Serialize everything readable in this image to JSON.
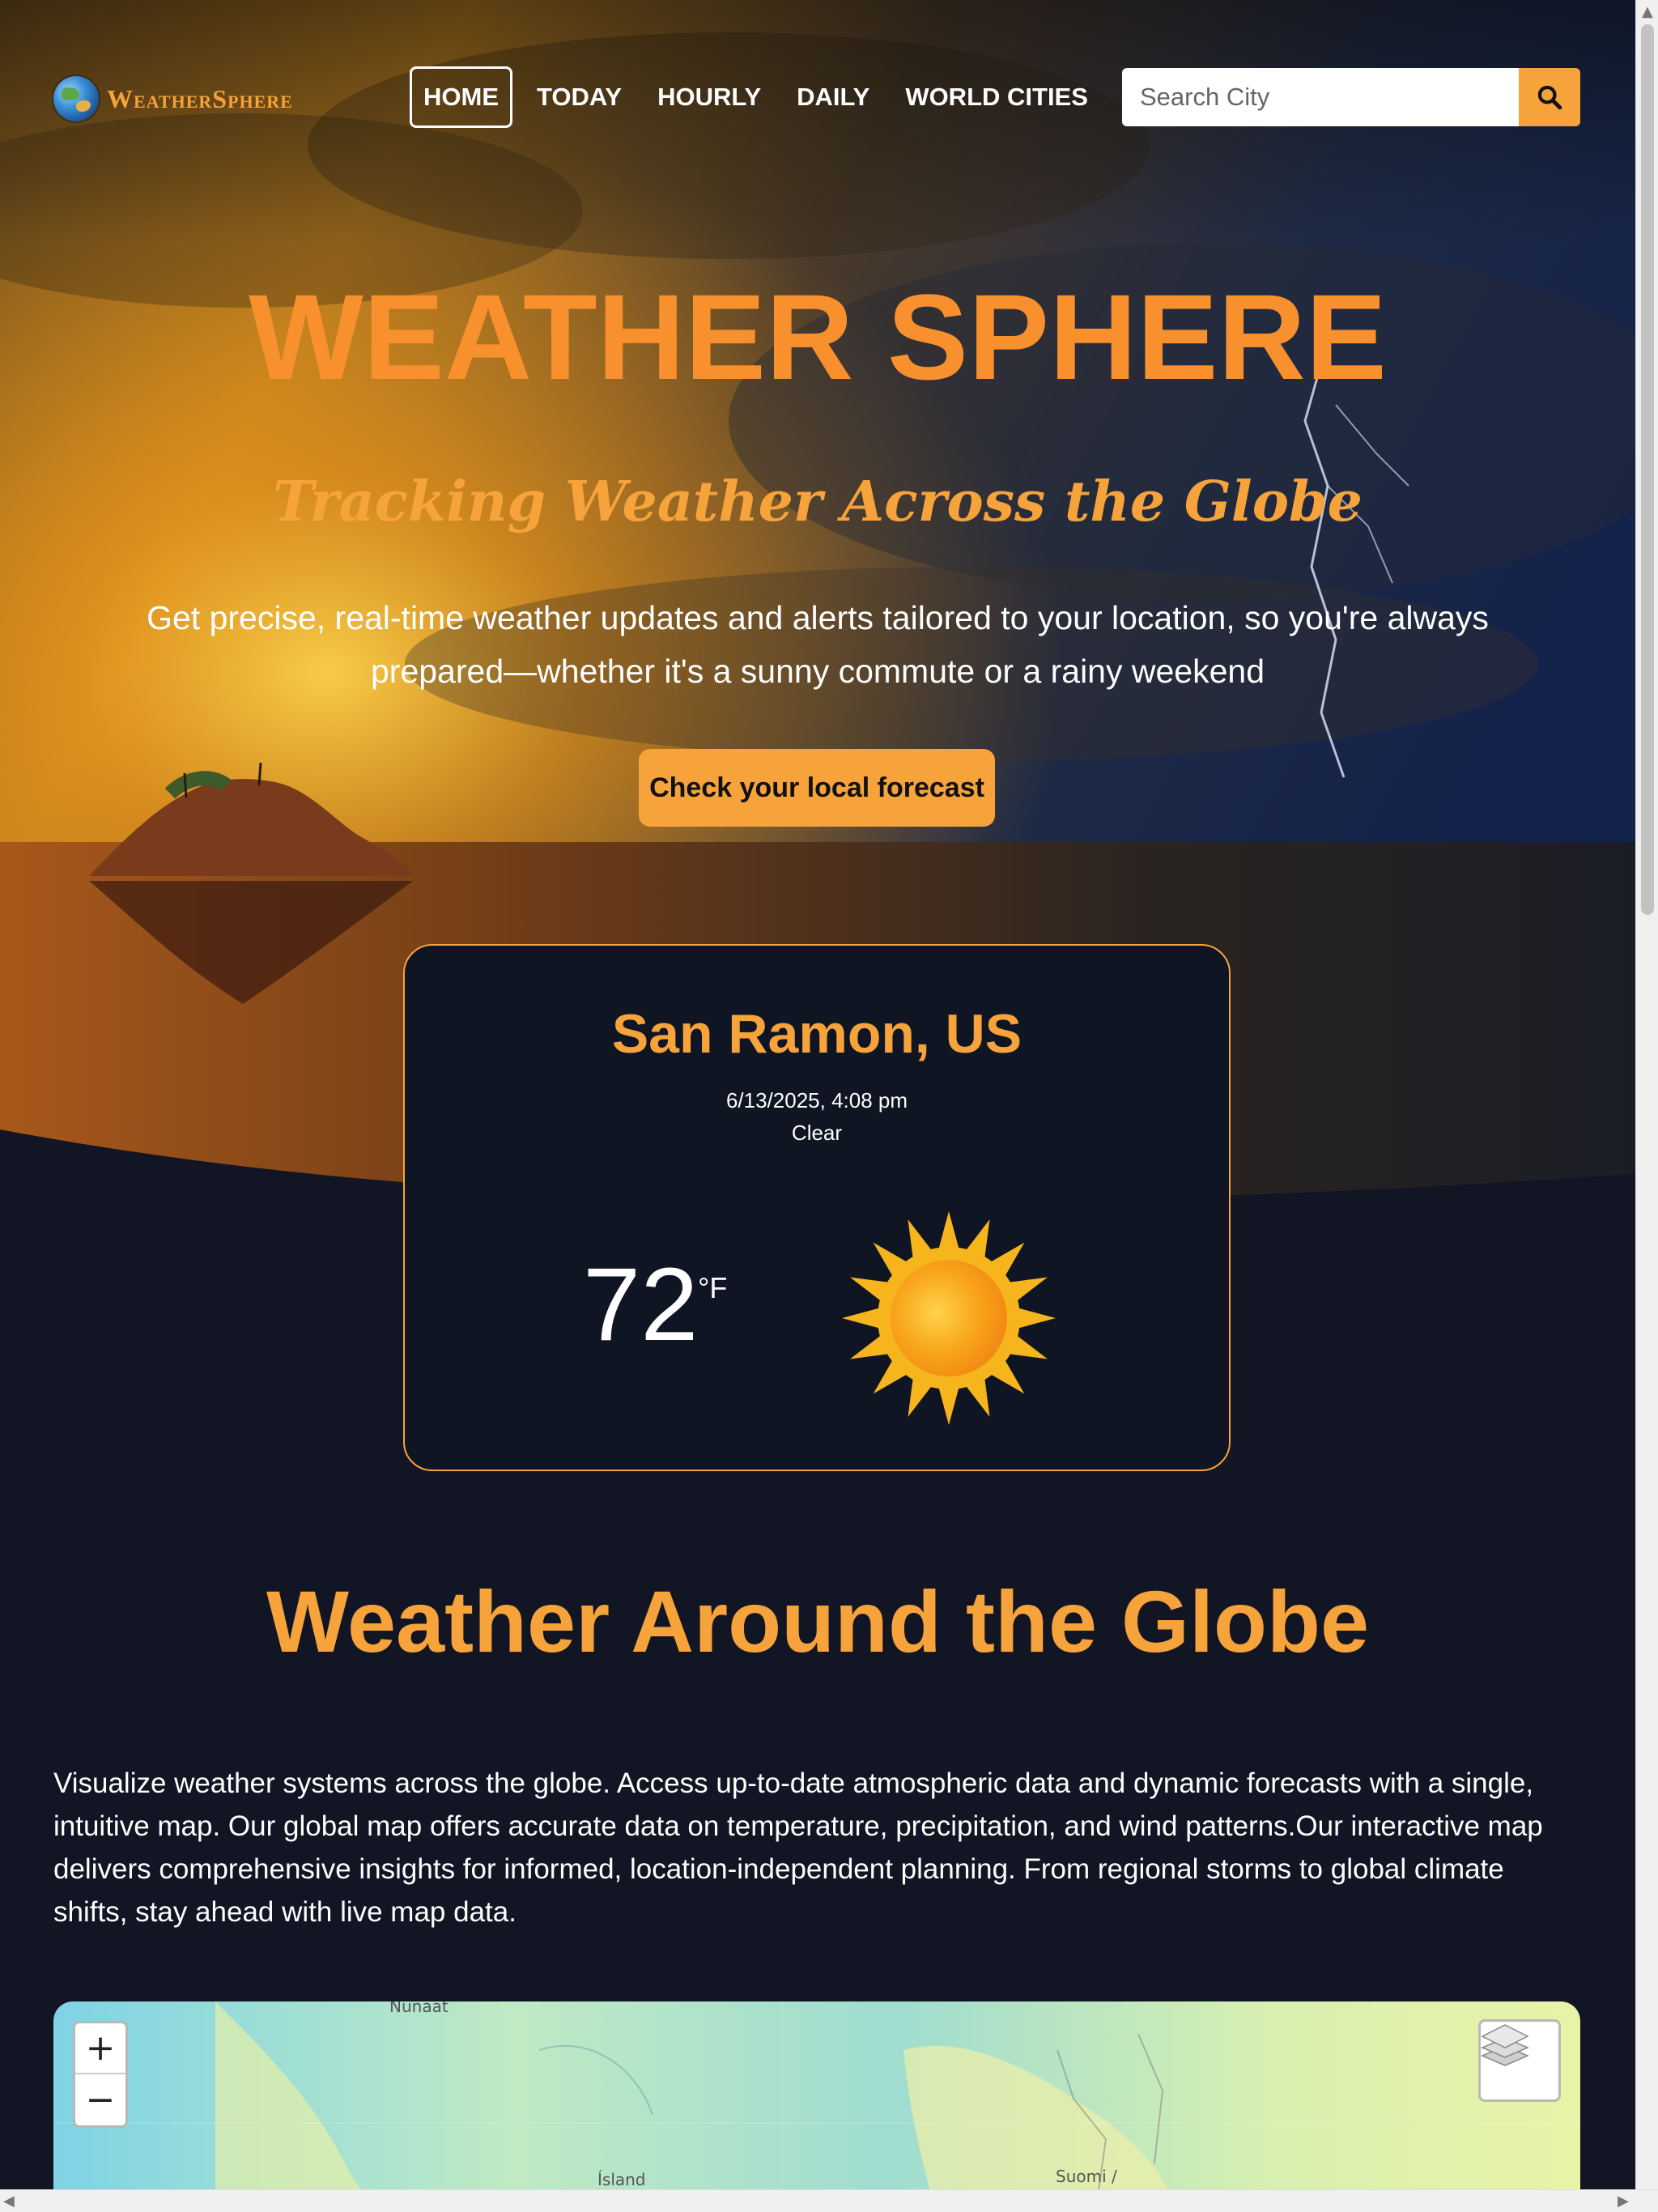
{
  "brand": {
    "logo_text": "WeatherSphere"
  },
  "nav": {
    "items": [
      {
        "label": "HOME",
        "active": true
      },
      {
        "label": "TODAY"
      },
      {
        "label": "HOURLY"
      },
      {
        "label": "DAILY"
      },
      {
        "label": "WORLD CITIES"
      }
    ]
  },
  "search": {
    "placeholder": "Search City",
    "value": "",
    "button_icon": "search-icon"
  },
  "hero": {
    "title": "WEATHER SPHERE",
    "tagline": "Tracking Weather Across the Globe",
    "description": "Get precise, real-time weather updates and alerts tailored to your location, so you're always prepared—whether it's a sunny commute or a rainy weekend",
    "cta_label": "Check your local forecast"
  },
  "current": {
    "city": "San Ramon, US",
    "datetime": "6/13/2025, 4:08 pm",
    "condition": "Clear",
    "temperature": "72",
    "unit": "°F",
    "icon": "sun-icon"
  },
  "globe_section": {
    "title": "Weather Around the Globe",
    "text": "Visualize weather systems across the globe. Access up-to-date atmospheric data and dynamic forecasts with a single, intuitive map. Our global map offers accurate data on temperature, precipitation, and wind patterns.Our interactive map delivers comprehensive insights for informed, location-independent planning. From regional storms to global climate shifts, stay ahead with live map data."
  },
  "map": {
    "zoom_in": "+",
    "zoom_out": "−",
    "labels": [
      "Nunaat",
      "Ísland",
      "Suomi /"
    ],
    "layers_icon": "layers-icon"
  },
  "colors": {
    "accent": "#f7a33b",
    "title_orange": "#f7902d",
    "background": "#111524"
  }
}
